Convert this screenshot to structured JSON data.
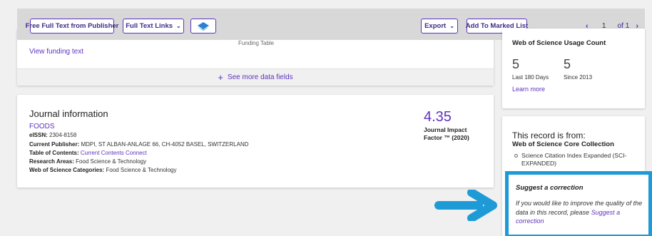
{
  "toolbar": {
    "free_full_text": "Free Full Text from Publisher",
    "full_text_links": "Full Text Links",
    "export": "Export",
    "add_to_marked_list": "Add To Marked List",
    "page_current": "1",
    "page_total": "of 1"
  },
  "funding": {
    "table_label": "Funding Table",
    "view_funding_text": "View funding text",
    "see_more": "See more data fields"
  },
  "journal": {
    "title": "Journal information",
    "name": "FOODS",
    "eissn_label": "eISSN:",
    "eissn_value": "2304-8158",
    "publisher_label": "Current Publisher:",
    "publisher_value": "MDPI, ST ALBAN-ANLAGE 66, CH-4052 BASEL, SWITZERLAND",
    "toc_label": "Table of Contents:",
    "toc_value": "Current Contents Connect",
    "research_label": "Research Areas:",
    "research_value": "Food Science & Technology",
    "wos_cat_label": "Web of Science Categories:",
    "wos_cat_value": "Food Science & Technology",
    "impact_value": "4.35",
    "impact_label_1": "Journal Impact",
    "impact_label_2": "Factor ™ (2020)"
  },
  "usage": {
    "title": "Web of Science Usage Count",
    "count_180": "5",
    "label_180": "Last 180 Days",
    "count_2013": "5",
    "label_2013": "Since 2013",
    "learn_more": "Learn more"
  },
  "record": {
    "heading": "This record is from:",
    "collection": "Web of Science Core Collection",
    "index_item": "Science Citation Index Expanded (SCI-EXPANDED)"
  },
  "correction": {
    "title": "Suggest a correction",
    "body": "If you would like to improve the quality of the data in this record, please",
    "link": "Suggest a correction"
  },
  "colors": {
    "accent": "#5e33bf",
    "highlight": "#1e9bd7"
  }
}
